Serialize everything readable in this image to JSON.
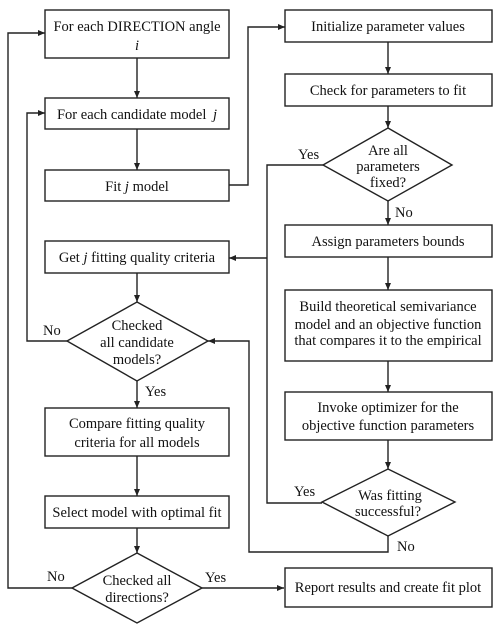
{
  "nodes": {
    "direction_loop": {
      "text": "For each DIRECTION angle",
      "var": "i"
    },
    "model_loop": {
      "text": "For each candidate model",
      "var": "j"
    },
    "fit_model": {
      "pre": "Fit",
      "var": "j",
      "post": "model"
    },
    "get_criteria": {
      "pre": "Get",
      "var": "j",
      "post": "fitting quality criteria"
    },
    "checked_models": {
      "lines": [
        "Checked",
        "all candidate",
        "models?"
      ]
    },
    "compare": {
      "lines": [
        "Compare fitting quality",
        "criteria for all models"
      ]
    },
    "select": {
      "text": "Select model with optimal fit"
    },
    "checked_directions": {
      "lines": [
        "Checked all",
        "directions?"
      ]
    },
    "initialize": {
      "text": "Initialize parameter values"
    },
    "check_params": {
      "text": "Check for parameters to fit"
    },
    "all_fixed": {
      "lines": [
        "Are all",
        "parameters",
        "fixed?"
      ]
    },
    "assign_bounds": {
      "text": "Assign parameters bounds"
    },
    "build_model": {
      "lines": [
        "Build theoretical semivariance",
        "model and an objective function",
        "that compares it to the empirical"
      ]
    },
    "invoke_optimizer": {
      "lines": [
        "Invoke optimizer for the",
        "objective function parameters"
      ]
    },
    "fit_success": {
      "lines": [
        "Was fitting",
        "successful?"
      ]
    },
    "report": {
      "text": "Report results and create fit plot"
    }
  },
  "labels": {
    "models_no": "No",
    "models_yes": "Yes",
    "directions_no": "No",
    "directions_yes": "Yes",
    "fixed_yes": "Yes",
    "fixed_no": "No",
    "success_yes": "Yes",
    "success_no": "No"
  }
}
